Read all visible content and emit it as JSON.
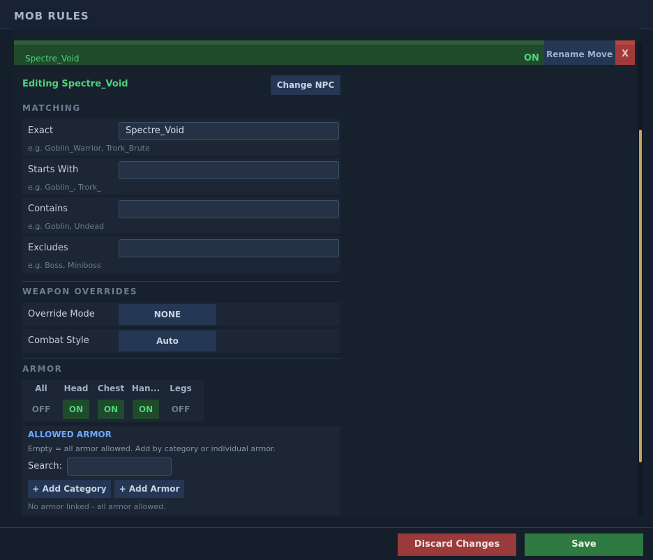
{
  "header": {
    "title": "MOB RULES"
  },
  "rule": {
    "name": "Spectre_Void",
    "status": "ON",
    "rename_label": "Rename",
    "move_label": "Move",
    "delete_label": "X"
  },
  "editor": {
    "editing_label": "Editing Spectre_Void",
    "change_npc_label": "Change NPC"
  },
  "matching": {
    "section_title": "MATCHING",
    "fields": [
      {
        "label": "Exact",
        "value": "Spectre_Void",
        "hint": "e.g. Goblin_Warrior, Trork_Brute"
      },
      {
        "label": "Starts With",
        "value": "",
        "hint": "e.g. Goblin_, Trork_"
      },
      {
        "label": "Contains",
        "value": "",
        "hint": "e.g. Goblin, Undead"
      },
      {
        "label": "Excludes",
        "value": "",
        "hint": "e.g. Boss, Miniboss"
      }
    ]
  },
  "weapon_overrides": {
    "section_title": "WEAPON OVERRIDES",
    "override_mode": {
      "label": "Override Mode",
      "value": "NONE"
    },
    "combat_style": {
      "label": "Combat Style",
      "value": "Auto"
    }
  },
  "armor": {
    "section_title": "ARMOR",
    "slots": [
      {
        "label": "All",
        "state": "OFF"
      },
      {
        "label": "Head",
        "state": "ON"
      },
      {
        "label": "Chest",
        "state": "ON"
      },
      {
        "label": "Han...",
        "state": "ON"
      },
      {
        "label": "Legs",
        "state": "OFF"
      }
    ]
  },
  "allowed_armor": {
    "title": "ALLOWED ARMOR",
    "description": "Empty = all armor allowed. Add by category or individual armor.",
    "search_label": "Search:",
    "search_value": "",
    "add_category_label": "+ Add Category",
    "add_armor_label": "+ Add Armor",
    "empty_note": "No armor linked  - all armor allowed."
  },
  "footer": {
    "discard_label": "Discard Changes",
    "save_label": "Save"
  },
  "colors": {
    "accent_green": "#4fd37a",
    "link_blue": "#6ea8ff",
    "danger_red": "#9a3a3a",
    "save_green": "#2f7a41",
    "scroll_thumb": "#c9a25a"
  }
}
